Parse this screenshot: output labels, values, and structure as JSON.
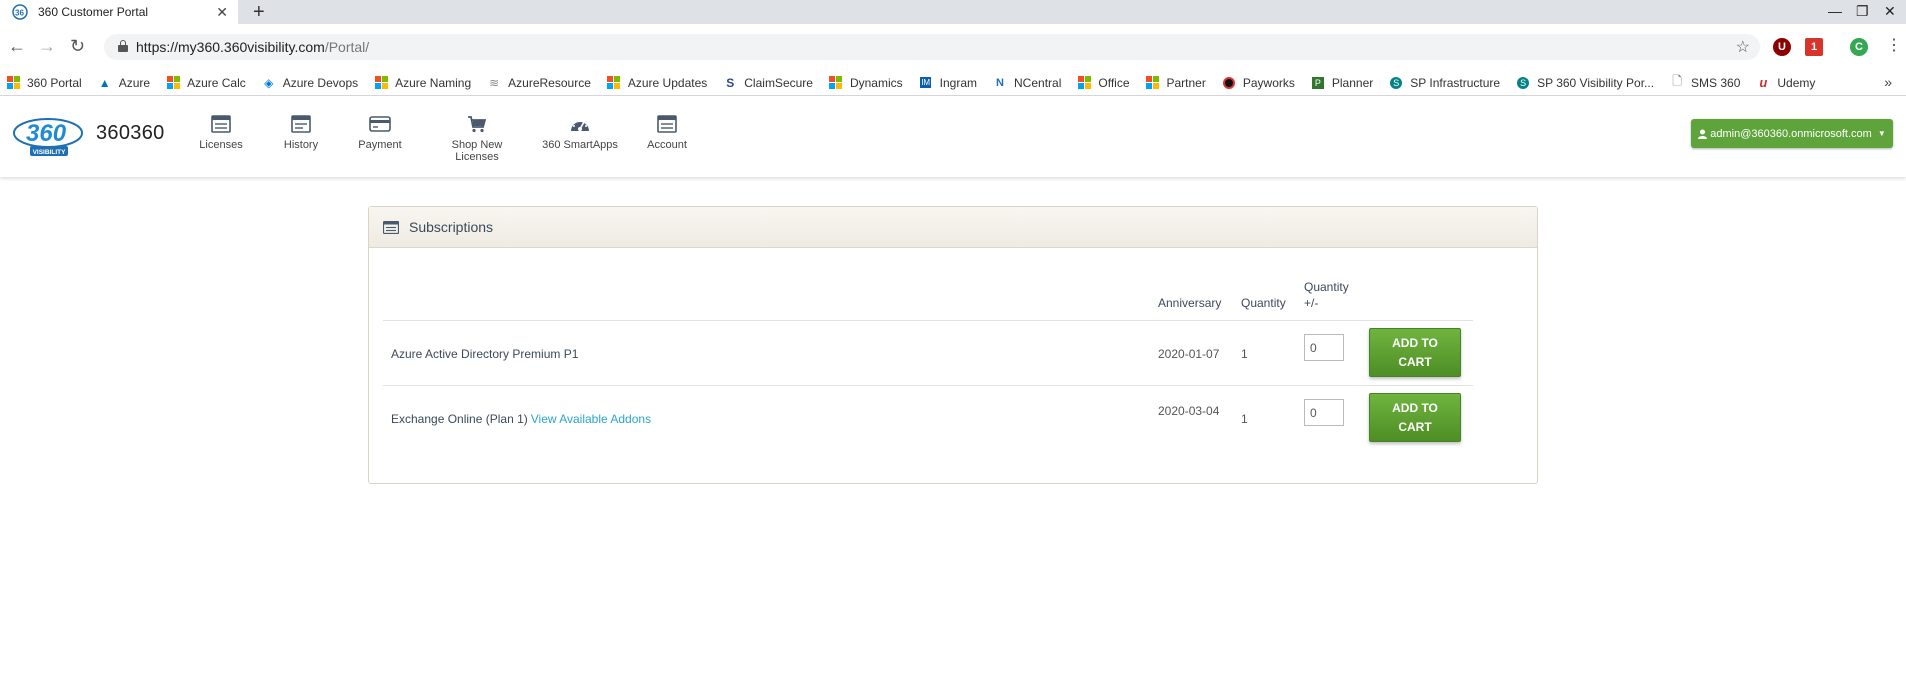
{
  "browser": {
    "tab_title": "360 Customer Portal",
    "url_host": "https://my360.360visibility.com",
    "url_path": "/Portal/",
    "bookmarks": [
      {
        "label": "360 Portal",
        "icon": "microsoft-icon"
      },
      {
        "label": "Azure",
        "icon": "azure-icon"
      },
      {
        "label": "Azure Calc",
        "icon": "microsoft-icon"
      },
      {
        "label": "Azure Devops",
        "icon": "devops-icon"
      },
      {
        "label": "Azure Naming",
        "icon": "microsoft-icon"
      },
      {
        "label": "AzureResource",
        "icon": "document-icon"
      },
      {
        "label": "Azure Updates",
        "icon": "microsoft-icon"
      },
      {
        "label": "ClaimSecure",
        "icon": "claimsecure-icon"
      },
      {
        "label": "Dynamics",
        "icon": "microsoft-icon"
      },
      {
        "label": "Ingram",
        "icon": "im-icon"
      },
      {
        "label": "NCentral",
        "icon": "ncentral-icon"
      },
      {
        "label": "Office",
        "icon": "microsoft-icon"
      },
      {
        "label": "Partner",
        "icon": "microsoft-icon"
      },
      {
        "label": "Payworks",
        "icon": "payworks-icon"
      },
      {
        "label": "Planner",
        "icon": "planner-icon"
      },
      {
        "label": "SP Infrastructure",
        "icon": "sharepoint-icon"
      },
      {
        "label": "SP 360 Visibility Por...",
        "icon": "sharepoint-icon"
      },
      {
        "label": "SMS 360",
        "icon": "page-icon"
      },
      {
        "label": "Udemy",
        "icon": "udemy-icon"
      }
    ],
    "extensions": [
      {
        "label": "U",
        "color": "#8b0000"
      },
      {
        "label": "1",
        "color": "#d9342b"
      },
      {
        "label": "C",
        "color": "#34a853"
      }
    ]
  },
  "portal": {
    "brand": "360360",
    "logo_text": "360",
    "logo_sub": "VISIBILITY",
    "nav": [
      {
        "label": "Licenses",
        "icon": "licenses-icon"
      },
      {
        "label": "History",
        "icon": "history-icon"
      },
      {
        "label": "Payment",
        "icon": "credit-card-icon"
      },
      {
        "label": "Shop New Licenses",
        "icon": "cart-icon"
      },
      {
        "label": "360 SmartApps",
        "icon": "dashboard-icon"
      },
      {
        "label": "Account",
        "icon": "account-icon"
      }
    ],
    "user_email": "admin@360360.onmicrosoft.com"
  },
  "subscriptions": {
    "title": "Subscriptions",
    "columns": {
      "anniversary": "Anniversary",
      "quantity": "Quantity",
      "quantity_change": "Quantity +/-"
    },
    "rows": [
      {
        "product": "Azure Active Directory Premium P1",
        "link": "",
        "anniversary": "2020-01-07",
        "quantity": "1",
        "quantity_change": "0",
        "button": "ADD TO CART"
      },
      {
        "product": "Exchange Online (Plan 1)",
        "link": "View Available Addons",
        "anniversary": "2020-03-04",
        "quantity": "1",
        "quantity_change": "0",
        "button": "ADD TO CART"
      }
    ]
  },
  "colors": {
    "accent_green": "#5fa33b",
    "link_blue": "#2aa6c9"
  }
}
